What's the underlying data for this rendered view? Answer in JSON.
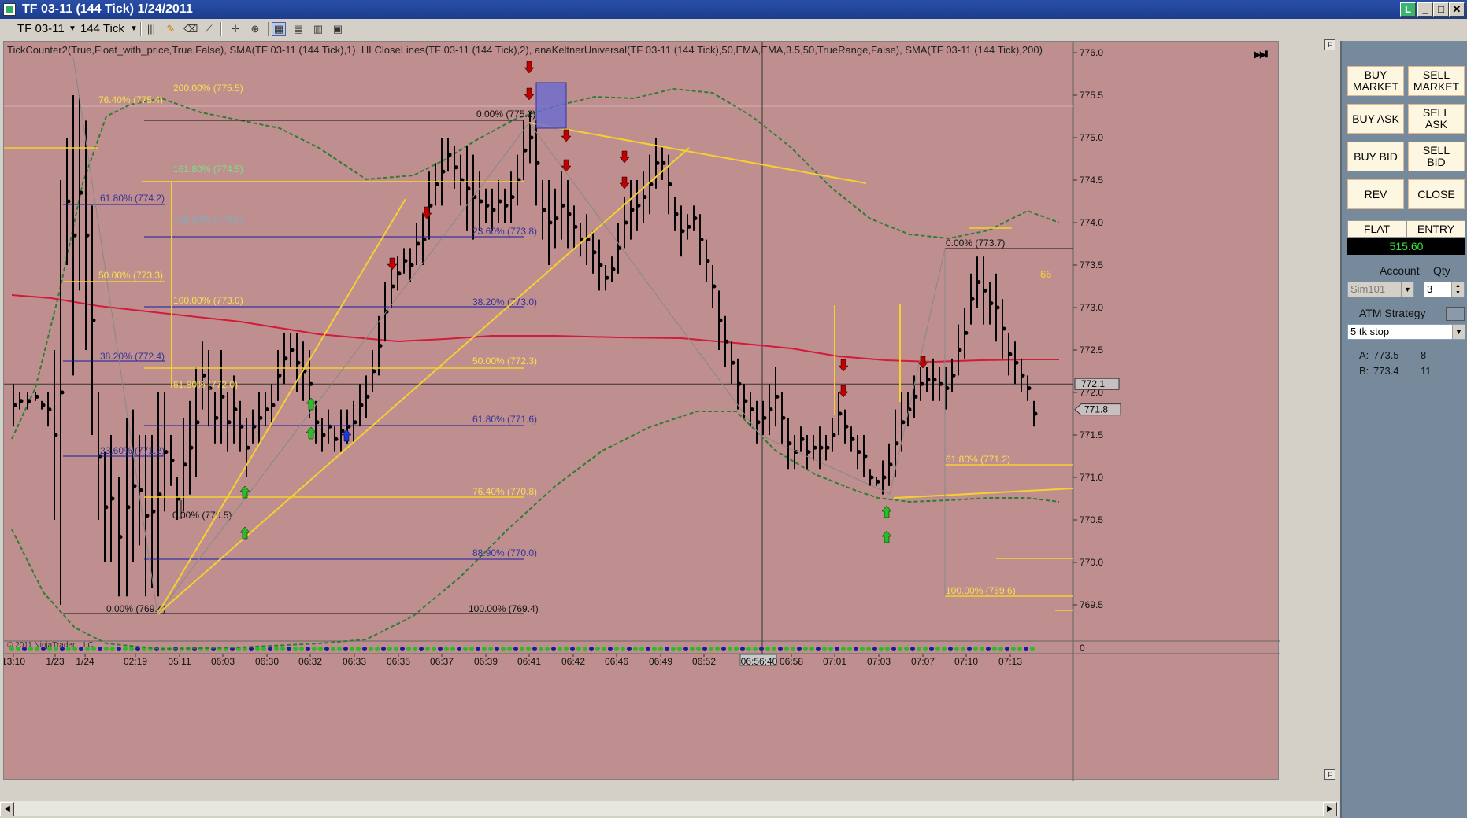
{
  "window": {
    "title": "TF 03-11 (144 Tick)  1/24/2011",
    "controls": {
      "restore": "L",
      "minimize": "_",
      "maximize": "□",
      "close": "✕"
    }
  },
  "toolbar": {
    "instrument": "TF 03-11",
    "period": "144 Tick",
    "icons": [
      "bar-style-icon",
      "draw-pencil-icon",
      "eraser-icon",
      "crosshair-icon",
      "zoom-icon",
      "grid-icon",
      "properties-icon",
      "template-icon"
    ]
  },
  "chart": {
    "indicator_text": "TickCounter2(True,Float_with_price,True,False),  SMA(TF  03-11  (144  Tick),1),  HLCloseLines(TF  03-11  (144  Tick),2),  anaKeltnerUniversal(TF  03-11  (144  Tick),50,EMA,EMA,3.5,50,TrueRange,False),  SMA(TF  03-11  (144  Tick),200)",
    "copyright": "© 2011 NinjaTrader, LLC",
    "tick_counter": "66",
    "price_axis": [
      "776.0",
      "775.5",
      "775.0",
      "774.5",
      "774.0",
      "773.5",
      "773.0",
      "772.5",
      "772.0",
      "771.5",
      "771.0",
      "770.5",
      "770.0",
      "769.5"
    ],
    "volume_axis_zero": "0",
    "current_price_label": "772.1",
    "last_price_label": "771.8",
    "time_axis": [
      "13:10",
      "1/23",
      "1/24",
      "02:19",
      "05:11",
      "06:03",
      "06:30",
      "06:32",
      "06:33",
      "06:35",
      "06:37",
      "06:39",
      "06:41",
      "06:42",
      "06:46",
      "06:49",
      "06:52",
      "06:56:40",
      "06:58",
      "07:01",
      "07:03",
      "07:07",
      "07:10",
      "07:13"
    ],
    "fib_labels": [
      {
        "text": "76.40% (775.4)",
        "color": "#f5e050"
      },
      {
        "text": "200.00% (775.5)",
        "color": "#f5e050"
      },
      {
        "text": "0.00% (775.2)",
        "color": "#111111"
      },
      {
        "text": "161.80% (774.5)",
        "color": "#7ee07e"
      },
      {
        "text": "61.80% (774.2)",
        "color": "#333399"
      },
      {
        "text": "138.20% (774.0)",
        "color": "#7ab0c0"
      },
      {
        "text": "23.60% (773.8)",
        "color": "#333399"
      },
      {
        "text": "50.00% (773.3)",
        "color": "#f5e050"
      },
      {
        "text": "100.00% (773.0)",
        "color": "#f5e050"
      },
      {
        "text": "38.20% (773.0)",
        "color": "#333399"
      },
      {
        "text": "38.20% (772.4)",
        "color": "#333399"
      },
      {
        "text": "50.00% (772.3)",
        "color": "#f5e050"
      },
      {
        "text": "61.80% (772.0)",
        "color": "#f5e050"
      },
      {
        "text": "61.80% (771.6)",
        "color": "#333399"
      },
      {
        "text": "23.60% (771.2)",
        "color": "#333399"
      },
      {
        "text": "76.40% (770.8)",
        "color": "#f5e050"
      },
      {
        "text": "0.00% (770.5)",
        "color": "#111111"
      },
      {
        "text": "88.90% (770.0)",
        "color": "#333399"
      },
      {
        "text": "0.00% (769.4)",
        "color": "#111111"
      },
      {
        "text": "100.00% (769.4)",
        "color": "#111111"
      },
      {
        "text": "0.00% (773.7)",
        "color": "#111111"
      },
      {
        "text": "61.80% (771.2)",
        "color": "#f5e050"
      },
      {
        "text": "100.00% (769.6)",
        "color": "#f5e050"
      }
    ]
  },
  "order_panel": {
    "buy_market": "BUY\nMARKET",
    "sell_market": "SELL\nMARKET",
    "buy_ask": "BUY ASK",
    "sell_ask": "SELL\nASK",
    "buy_bid": "BUY BID",
    "sell_bid": "SELL\nBID",
    "rev": "REV",
    "close": "CLOSE",
    "position": "FLAT",
    "entry": "ENTRY",
    "pnl": "515.60",
    "account_label": "Account",
    "qty_label": "Qty",
    "account_value": "Sim101",
    "qty_value": "3",
    "atm_label": "ATM Strategy",
    "atm_value": "5 tk stop",
    "ask_label": "A:",
    "ask_price": "773.5",
    "ask_size": "8",
    "bid_label": "B:",
    "bid_price": "773.4",
    "bid_size": "11"
  },
  "colors": {
    "chart_bg": "#bf8f8f",
    "keltner": "#2e7d32",
    "sma200": "#d21a3a",
    "fib_yellow": "#f5d030",
    "fib_blue": "#1a1aa0",
    "arrow_red": "#c00000",
    "arrow_green": "#22c022",
    "arrow_blue": "#1a3ae0"
  }
}
